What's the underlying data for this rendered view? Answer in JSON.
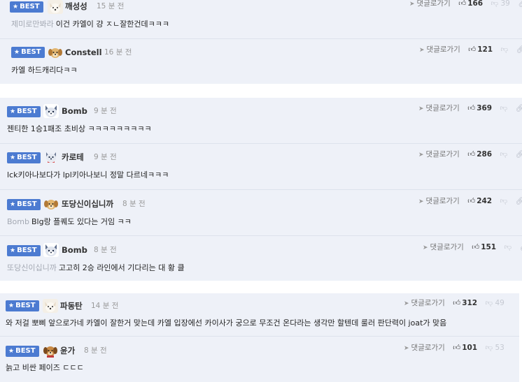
{
  "ui": {
    "reply_label": "댓글로가기",
    "best_label": "BEST",
    "accent": "#4c7bd1"
  },
  "comments": [
    {
      "nick": "깨성성",
      "time": "15 분 전",
      "mention": "제미로만봐라",
      "text": "이건 카엘이 걍 ㅈㄴ잘한건데ㅋㅋㅋ",
      "likes": "166",
      "dislikes": "39",
      "avatar": "white-dog"
    },
    {
      "nick": "Constell",
      "time": "16 분 전",
      "mention": "",
      "text": "카엘 하드캐리다ㅋㅋ",
      "likes": "121",
      "dislikes": "",
      "avatar": "puppy"
    },
    {
      "nick": "Bomb",
      "time": "9 분 전",
      "mention": "",
      "text": "젠티한 1승1패조 초비상 ㅋㅋㅋㅋㅋㅋㅋㅋㅋ",
      "likes": "369",
      "dislikes": "",
      "avatar": "husky"
    },
    {
      "nick": "카로테",
      "time": "9 분 전",
      "mention": "",
      "text": "lck키아나보다가 lpl키아나보니 정말 다르네ㅋㅋㅋ",
      "likes": "286",
      "dislikes": "",
      "avatar": "husky-small"
    },
    {
      "nick": "또당신이십니까",
      "time": "8 분 전",
      "mention": "Bomb",
      "text": "Blg랑 플퀘도 있다는 거임 ㅋㅋ",
      "likes": "242",
      "dislikes": "",
      "avatar": "puppy"
    },
    {
      "nick": "Bomb",
      "time": "8 분 전",
      "mention": "또당신이십니까",
      "text": "고고히 2승 라인에서 기다리는 대 황 클",
      "likes": "151",
      "dislikes": "",
      "avatar": "husky"
    },
    {
      "nick": "파동탄",
      "time": "14 분 전",
      "mention": "",
      "text": "와 저걸 뽀삐 앞으로가네 카엘이 잘한거 맞는데 카엘 입장에선 카이사가 궁으로 무조건 온다라는 생각만 할텐데 룰러 판단력이 joat가 맞음",
      "likes": "312",
      "dislikes": "49",
      "avatar": "white-dog"
    },
    {
      "nick": "윤가",
      "time": "8 분 전",
      "mention": "",
      "text": "늙고 비싼 페이즈 ㄷㄷㄷ",
      "likes": "101",
      "dislikes": "53",
      "avatar": "puppy-dark"
    }
  ]
}
